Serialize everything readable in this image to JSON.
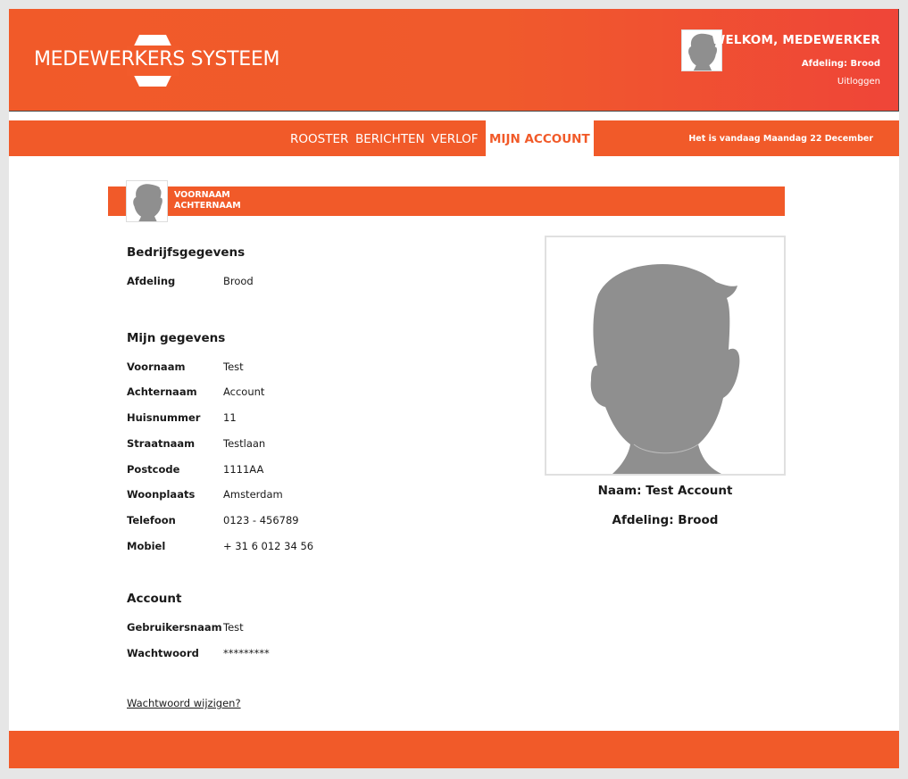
{
  "app": {
    "logo_text": "MEDEWERKERS SYSTEEM"
  },
  "header": {
    "welcome": "WELKOM, MEDEWERKER",
    "department": "Afdeling: Brood",
    "logout": "Uitloggen"
  },
  "nav": {
    "items": [
      {
        "label": "ROOSTER"
      },
      {
        "label": "BERICHTEN"
      },
      {
        "label": "VERLOF"
      },
      {
        "label": "MIJN ACCOUNT"
      }
    ],
    "active": "MIJN ACCOUNT",
    "today": "Het is vandaag Maandag 22 December"
  },
  "profile_bar": {
    "first_name": "VOORNAAM",
    "last_name": "ACHTERNAAM"
  },
  "company": {
    "title": "Bedrijfsgegevens",
    "rows": [
      {
        "label": "Afdeling",
        "value": "Brood"
      }
    ]
  },
  "personal": {
    "title": "Mijn gegevens",
    "rows": [
      {
        "label": "Voornaam",
        "value": "Test"
      },
      {
        "label": "Achternaam",
        "value": "Account"
      },
      {
        "label": "Huisnummer",
        "value": "11"
      },
      {
        "label": "Straatnaam",
        "value": "Testlaan"
      },
      {
        "label": "Postcode",
        "value": "1111AA"
      },
      {
        "label": "Woonplaats",
        "value": "Amsterdam"
      },
      {
        "label": "Telefoon",
        "value": "0123 - 456789"
      },
      {
        "label": "Mobiel",
        "value": "+ 31 6 012 34 56"
      }
    ]
  },
  "account": {
    "title": "Account",
    "rows": [
      {
        "label": "Gebruikersnaam",
        "value": "Test"
      },
      {
        "label": "Wachtwoord",
        "value": "*********"
      }
    ],
    "change_password": "Wachtwoord wijzigen?"
  },
  "photo": {
    "name": "Naam: Test Account",
    "department": "Afdeling: Brood"
  },
  "colors": {
    "accent": "#f15a29",
    "avatar_gray": "#8f8f8f"
  }
}
